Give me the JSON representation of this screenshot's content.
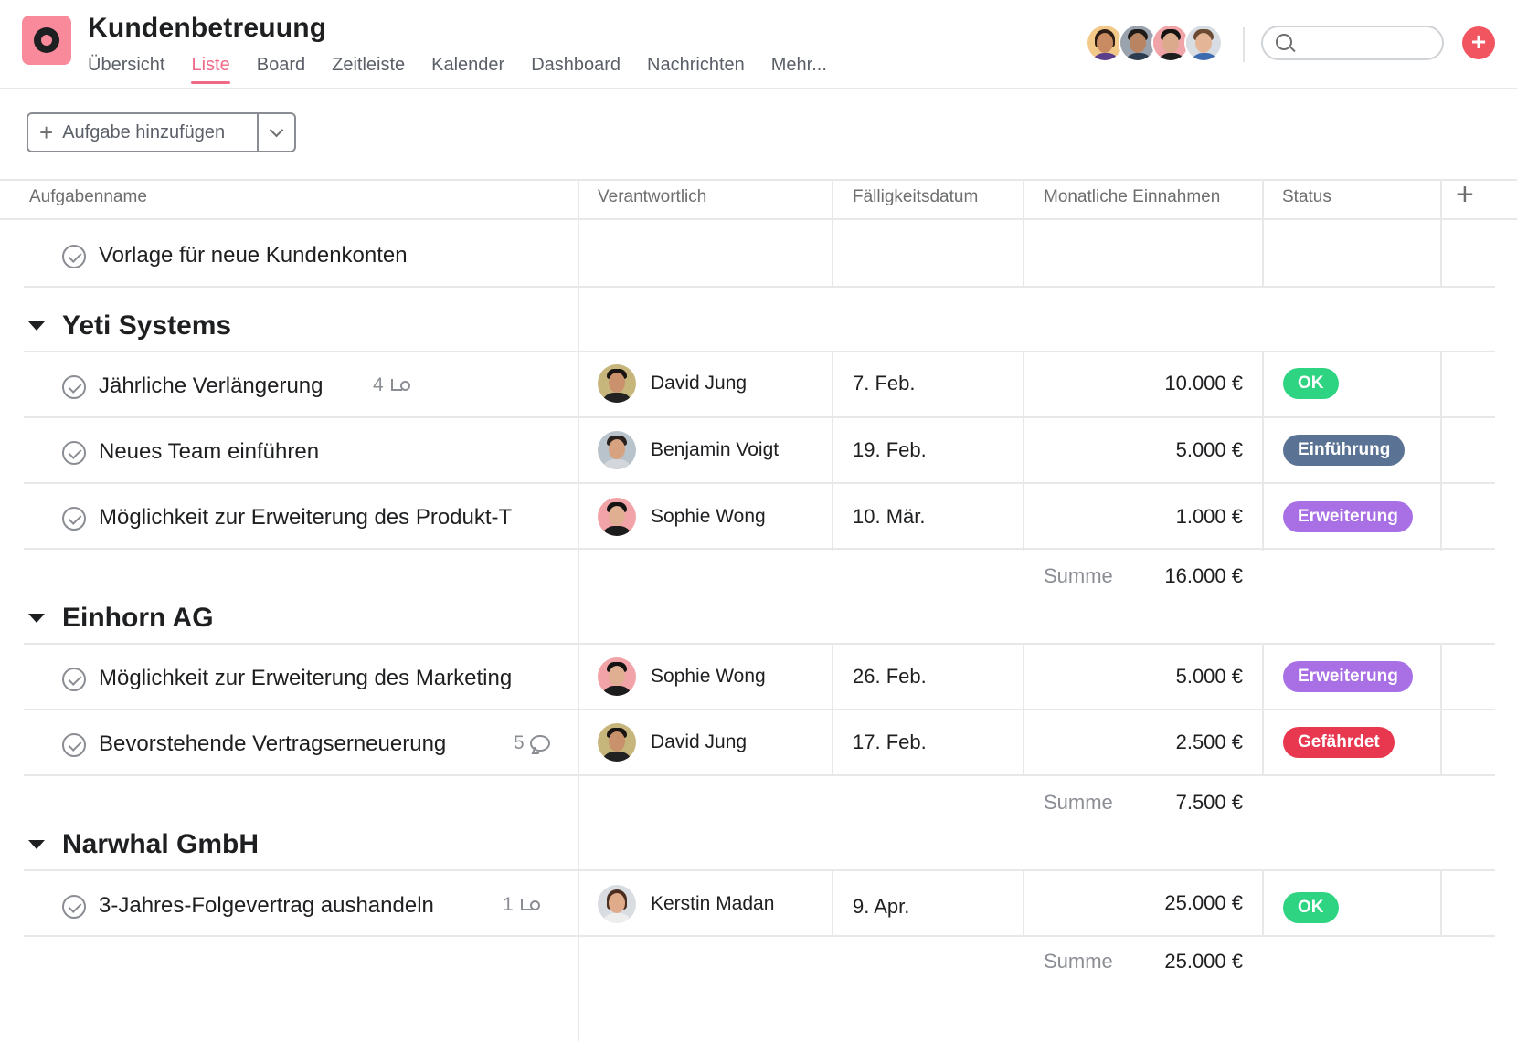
{
  "project": {
    "title": "Kundenbetreuung"
  },
  "tabs": [
    "Übersicht",
    "Liste",
    "Board",
    "Zeitleiste",
    "Kalender",
    "Dashboard",
    "Nachrichten",
    "Mehr..."
  ],
  "active_tab": "Liste",
  "colors": {
    "accent": "#f06a87",
    "app_icon": "#f88a9c",
    "new_button": "#f1555f",
    "status_ok": "#2ed481",
    "status_einfuehrung": "#5a7394",
    "status_erweiterung": "#a970e6",
    "status_gefaehrdet": "#e8384f"
  },
  "toolbar": {
    "add_task": "Aufgabe hinzufügen"
  },
  "columns": {
    "name": "Aufgabenname",
    "assignee": "Verantwortlich",
    "due": "Fälligkeitsdatum",
    "revenue": "Monatliche Einnahmen",
    "status": "Status",
    "add": "+"
  },
  "template_task": {
    "name": "Vorlage für neue Kundenkonten"
  },
  "sections": [
    {
      "name": "Yeti Systems",
      "tasks": [
        {
          "name": "Jährliche Verlängerung",
          "meta_count": "4",
          "meta_icon": "subtask-icon",
          "assignee": "David Jung",
          "due": "7. Feb.",
          "revenue": "10.000 €",
          "status": "OK"
        },
        {
          "name": "Neues Team einführen",
          "assignee": "Benjamin Voigt",
          "due": "19. Feb.",
          "revenue": "5.000 €",
          "status": "Einführung"
        },
        {
          "name": "Möglichkeit zur Erweiterung des Produkt-T",
          "assignee": "Sophie Wong",
          "due": "10. Mär.",
          "revenue": "1.000 €",
          "status": "Erweiterung"
        }
      ],
      "sum_label": "Summe",
      "sum": "16.000 €"
    },
    {
      "name": "Einhorn AG",
      "tasks": [
        {
          "name": "Möglichkeit zur Erweiterung des Marketing",
          "assignee": "Sophie Wong",
          "due": "26. Feb.",
          "revenue": "5.000 €",
          "status": "Erweiterung"
        },
        {
          "name": "Bevorstehende Vertragserneuerung",
          "meta_count": "5",
          "meta_icon": "comment-icon",
          "assignee": "David Jung",
          "due": "17. Feb.",
          "revenue": "2.500 €",
          "status": "Gefährdet"
        }
      ],
      "sum_label": "Summe",
      "sum": "7.500 €"
    },
    {
      "name": "Narwhal GmbH",
      "tasks": [
        {
          "name": "3-Jahres-Folgevertrag aushandeln",
          "meta_count": "1",
          "meta_icon": "subtask-icon",
          "assignee": "Kerstin Madan",
          "due": "9. Apr.",
          "revenue": "25.000 €",
          "status": "OK"
        }
      ],
      "sum_label": "Summe",
      "sum": "25.000 €"
    }
  ]
}
